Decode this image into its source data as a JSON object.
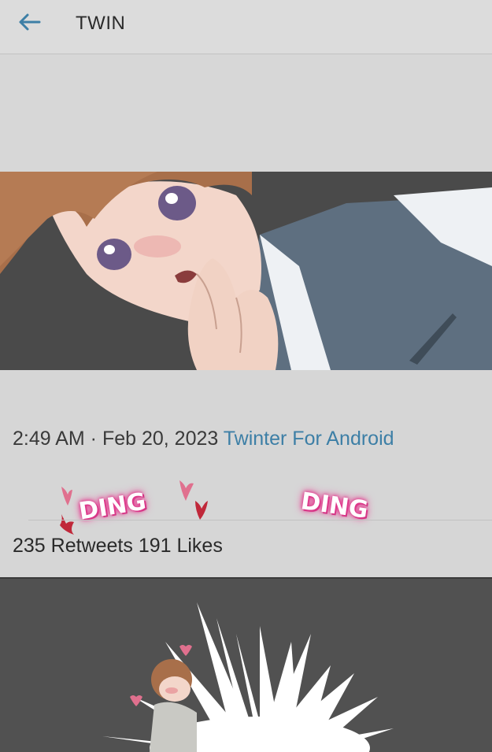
{
  "header": {
    "title": "TWIN",
    "back_icon": "arrow-left-icon"
  },
  "tweet": {
    "time": "2:49 AM · Feb 20, 2023",
    "source": "Twinter For Android",
    "stats": "235 Retweets 191 Likes"
  },
  "overlay": {
    "sfx_1": "DING",
    "sfx_2": "DING"
  },
  "colors": {
    "accent": "#3d7fa6",
    "sfx_glow": "#e0358a",
    "background": "#d6d6d6"
  }
}
